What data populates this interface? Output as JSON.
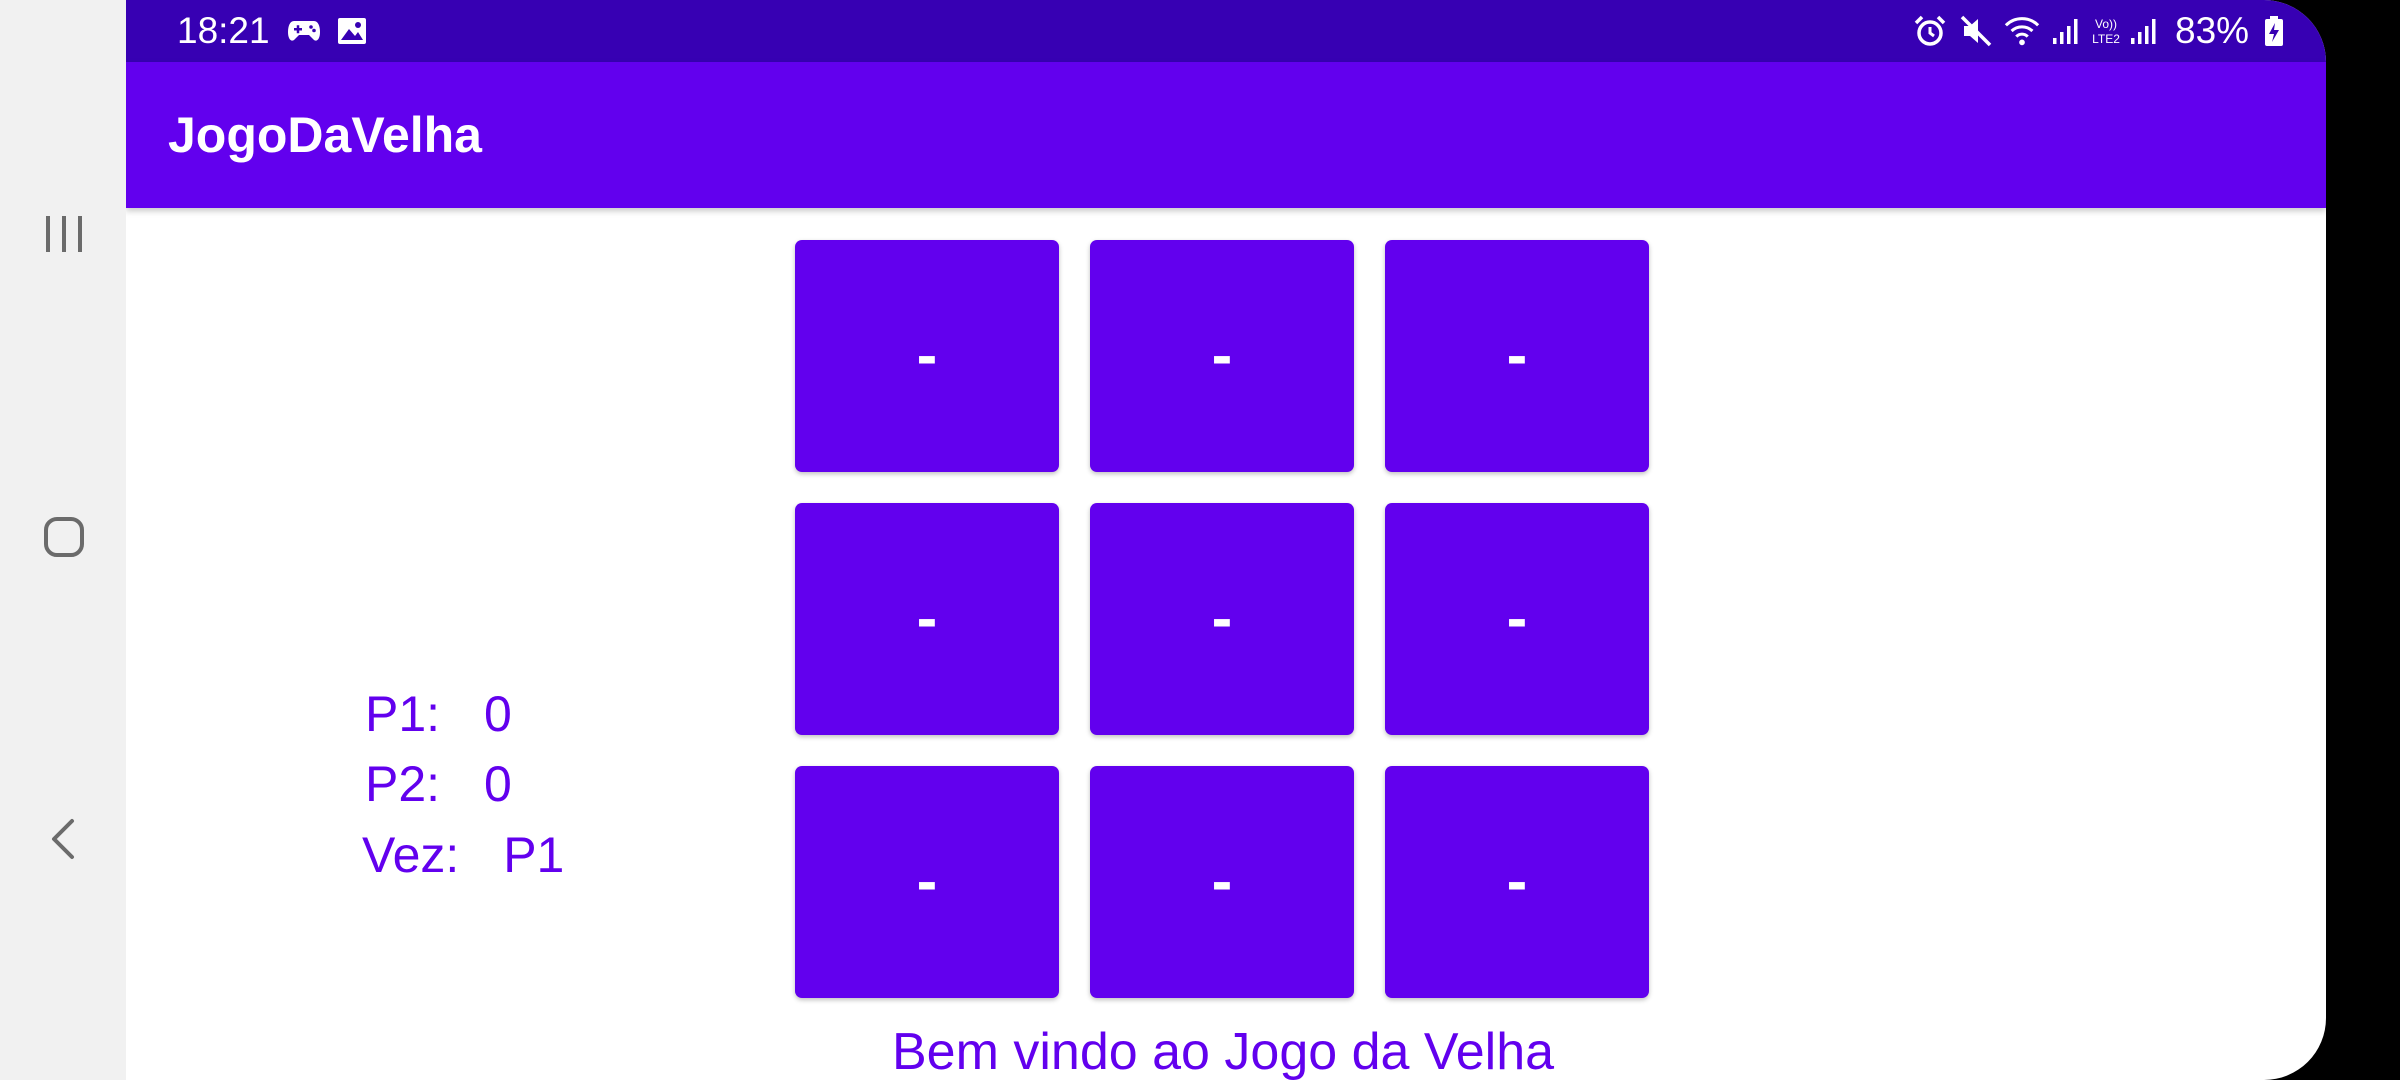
{
  "status_bar": {
    "time": "18:21",
    "battery": "83%",
    "left_icons": [
      "game-controller-icon",
      "image-icon"
    ],
    "right_icons": [
      "alarm-icon",
      "mute-icon",
      "wifi-icon",
      "signal-icon",
      "volte-lte2-icon",
      "signal-2-icon",
      "battery-charging-icon"
    ]
  },
  "app_bar": {
    "title": "JogoDaVelha"
  },
  "board": {
    "cells": [
      "-",
      "-",
      "-",
      "-",
      "-",
      "-",
      "-",
      "-",
      "-"
    ]
  },
  "scores": {
    "p1_label": "P1:",
    "p1_value": "0",
    "p2_label": "P2:",
    "p2_value": "0",
    "turn_label": "Vez:",
    "turn_value": "P1"
  },
  "welcome_message": "Bem vindo ao Jogo da Velha",
  "navigation": {
    "buttons": [
      "recents-icon",
      "home-icon",
      "back-icon"
    ]
  },
  "colors": {
    "primary": "#6200ee",
    "primary_dark": "#3700b3",
    "on_primary": "#ffffff"
  }
}
